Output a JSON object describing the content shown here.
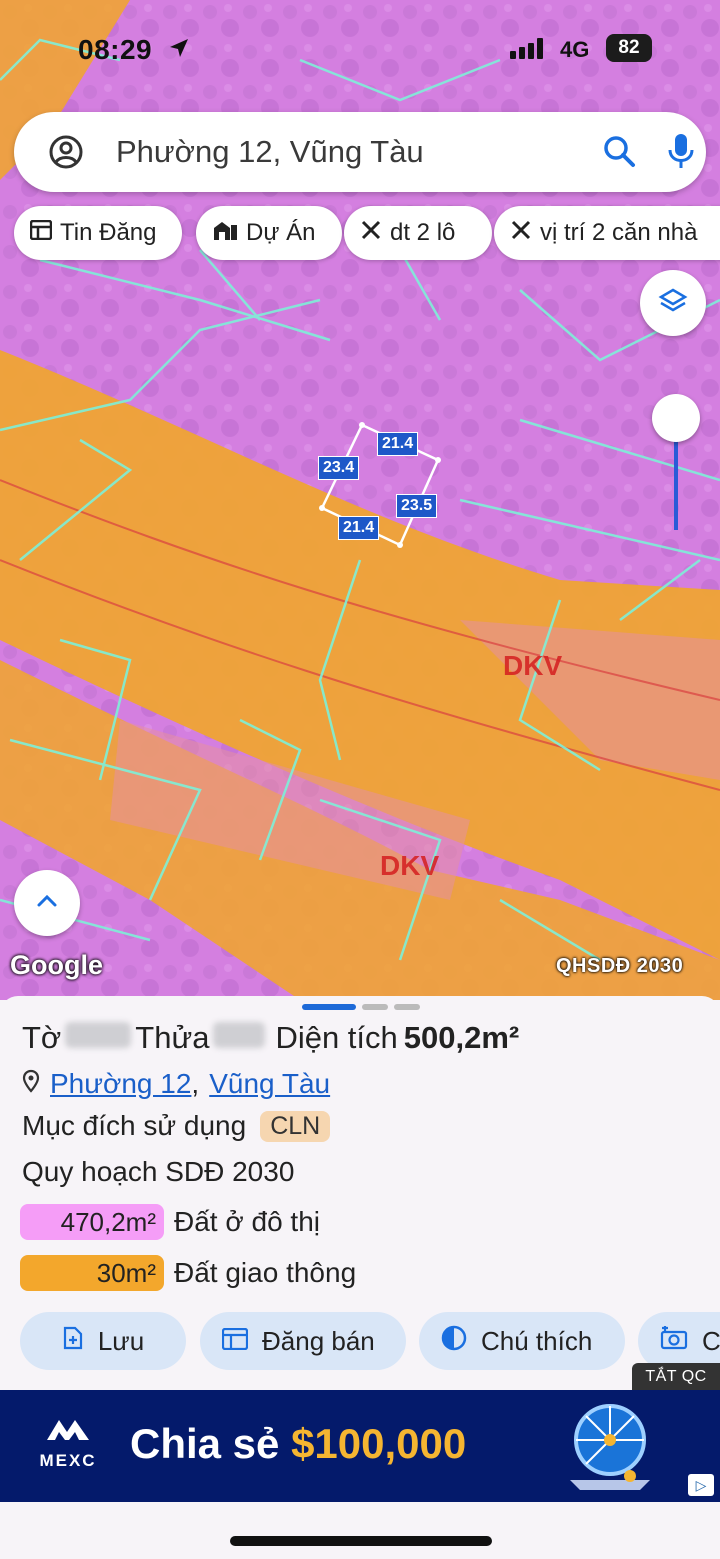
{
  "status_bar": {
    "time": "08:29",
    "network": "4G",
    "battery": "82",
    "icons": [
      "location-arrow-icon",
      "signal-icon"
    ]
  },
  "search": {
    "text": "Phường 12, Vũng Tàu",
    "icons": [
      "account-icon",
      "search-icon",
      "mic-icon"
    ]
  },
  "chips": [
    {
      "label": "Tin Đăng",
      "icon": "listing-icon"
    },
    {
      "label": "Dự Án",
      "icon": "project-icon"
    },
    {
      "label": "dt 2 lô",
      "icon": "measure-icon"
    },
    {
      "label": "vị trí 2 căn nhà",
      "icon": "measure-icon"
    }
  ],
  "map": {
    "dimensions": [
      "21.4",
      "23.4",
      "23.5",
      "21.4"
    ],
    "zone_labels": [
      "DKV",
      "DKV"
    ],
    "google": "Google",
    "badge": "QHSDĐ 2030",
    "colors": {
      "residential": "#e78bef",
      "transport": "#f1a830",
      "parcel_line": "#7ef0d8",
      "dimension": "#1e58c8"
    }
  },
  "parcel": {
    "sheet_label": "Tờ",
    "plot_label": "Thửa",
    "area_label": "Diện tích",
    "area_value": "500,2m²",
    "ward": "Phường 12",
    "separator": ",",
    "city": "Vũng Tàu",
    "purpose_label": "Mục đích sử dụng",
    "purpose_code": "CLN",
    "plan_label": "Quy hoạch SDĐ 2030",
    "zones": [
      {
        "area": "470,2m²",
        "name": "Đất ở đô thị",
        "color": "#f59df7"
      },
      {
        "area": "30m²",
        "name": "Đất giao thông",
        "color": "#f3a72c"
      }
    ]
  },
  "actions": [
    {
      "label": "Lưu",
      "icon": "bookmark-plus-icon"
    },
    {
      "label": "Đăng bán",
      "icon": "listing-icon"
    },
    {
      "label": "Chú thích",
      "icon": "legend-icon"
    },
    {
      "label": "C",
      "icon": "camera-icon"
    }
  ],
  "ad": {
    "close_label": "TẮT QC",
    "logo": "MEXC",
    "text": "Chia sẻ",
    "amount": "$100,000"
  }
}
